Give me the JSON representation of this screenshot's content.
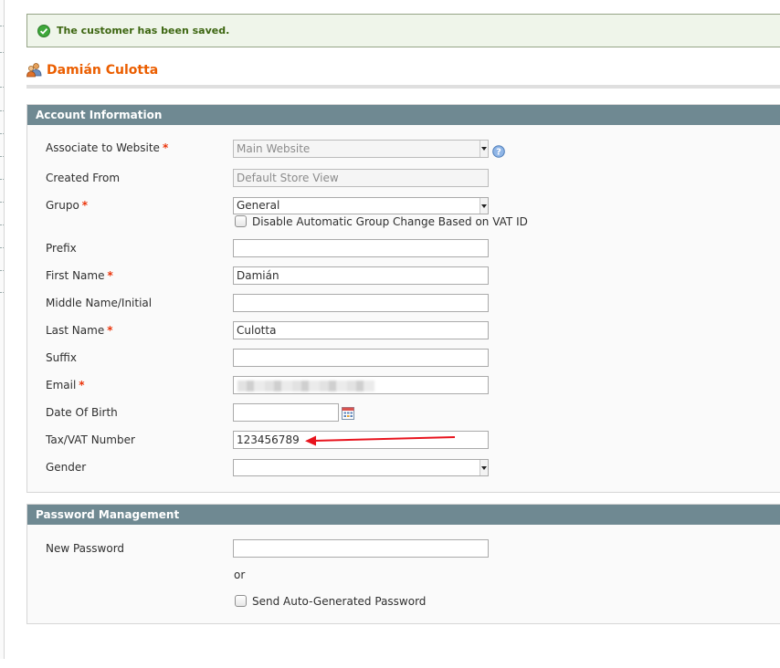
{
  "message": {
    "text": "The customer has been saved."
  },
  "page": {
    "title": "Damián Culotta"
  },
  "account": {
    "title": "Account Information",
    "website_label": "Associate to Website",
    "website_value": "Main Website",
    "created_from_label": "Created From",
    "created_from_value": "Default Store View",
    "group_label": "Grupo",
    "group_value": "General",
    "vat_checkbox_label": "Disable Automatic Group Change Based on VAT ID",
    "prefix_label": "Prefix",
    "prefix_value": "",
    "firstname_label": "First Name",
    "firstname_value": "Damián",
    "middlename_label": "Middle Name/Initial",
    "middlename_value": "",
    "lastname_label": "Last Name",
    "lastname_value": "Culotta",
    "suffix_label": "Suffix",
    "suffix_value": "",
    "email_label": "Email",
    "dob_label": "Date Of Birth",
    "dob_value": "",
    "taxvat_label": "Tax/VAT Number",
    "taxvat_value": "123456789",
    "gender_label": "Gender",
    "gender_value": "",
    "required_marker": "*"
  },
  "password": {
    "title": "Password Management",
    "new_password_label": "New Password",
    "or_text": "or",
    "auto_password_label": "Send Auto-Generated Password"
  },
  "colors": {
    "accent_title": "#eb5e00",
    "section_header": "#6f8992",
    "success_text": "#3d6611",
    "required": "#eb340a",
    "annotation_arrow": "#e8141e"
  },
  "icons": {
    "success": "check-circle-icon",
    "page": "customer-icon",
    "help": "help-icon",
    "calendar": "calendar-icon"
  }
}
